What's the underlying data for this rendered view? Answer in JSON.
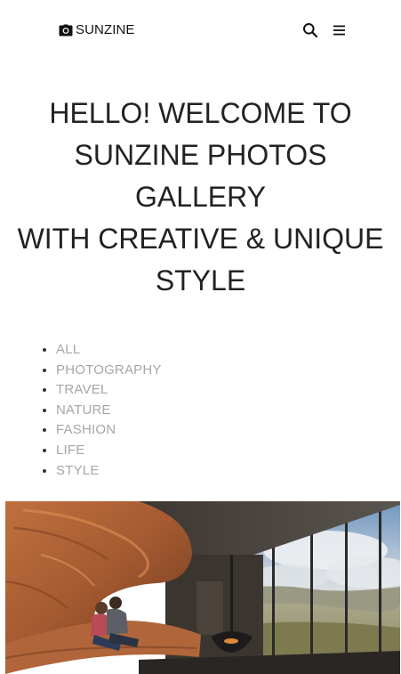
{
  "header": {
    "brand_text": "SUNZINE",
    "brand_icon": "camera-icon",
    "search_icon": "search-icon",
    "menu_icon": "hamburger-menu-icon"
  },
  "hero": {
    "line1": "HELLO! WELCOME TO",
    "line2": "SUNZINE PHOTOS",
    "line3": "GALLERY",
    "line4": "WITH CREATIVE & UNIQUE",
    "line5": "STYLE"
  },
  "categories": [
    "ALL",
    "PHOTOGRAPHY",
    "TRAVEL",
    "NATURE",
    "FASHION",
    "LIFE",
    "STYLE"
  ],
  "colors": {
    "text": "#222222",
    "category_link": "#a6a6a6",
    "background": "#ffffff"
  }
}
